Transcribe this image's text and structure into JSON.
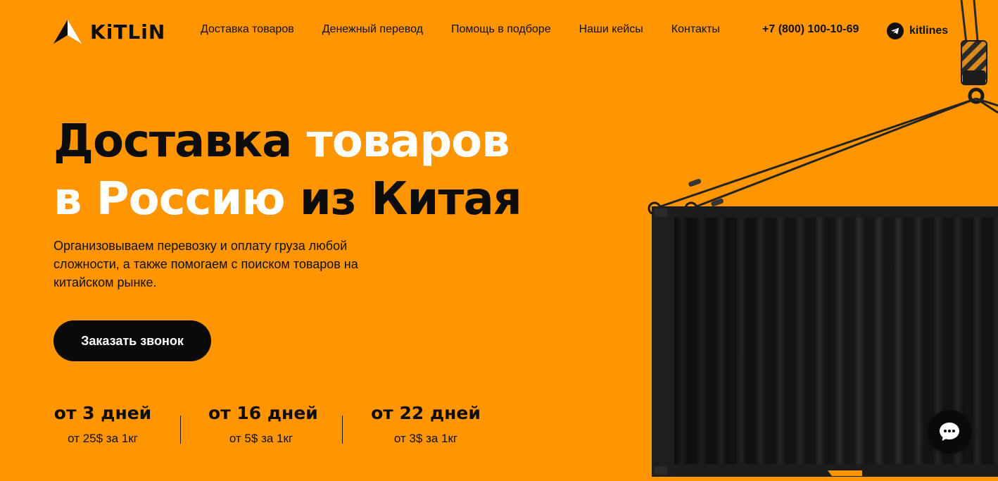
{
  "header": {
    "logo_text": "KiTLiN",
    "nav": [
      "Доставка товаров",
      "Денежный перевод",
      "Помощь в подборе",
      "Наши кейсы",
      "Контакты"
    ],
    "phone": "+7 (800) 100-10-69",
    "telegram_label": "kitlines"
  },
  "hero": {
    "title_line1_dark": "Доставка",
    "title_line1_light": "товаров",
    "title_line2_light": "в Россию",
    "title_line2_dark": "из Китая",
    "subtitle": "Организовываем перевозку и оплату груза любой сложности, а также помогаем с поиском товаров на китайском рынке.",
    "cta_label": "Заказать звонок"
  },
  "stats": [
    {
      "days": "от 3 дней",
      "price": "от 25$ за 1кг"
    },
    {
      "days": "от 16 дней",
      "price": "от 5$ за 1кг"
    },
    {
      "days": "от 22 дней",
      "price": "от 3$ за 1кг"
    }
  ],
  "colors": {
    "background": "#FF9500",
    "text_dark": "#0d0d0d",
    "text_light": "#ffffff",
    "button": "#0a0a0a"
  },
  "icons": {
    "logo": "kitlin-logo-icon",
    "telegram": "telegram-icon",
    "chat": "chat-icon"
  }
}
